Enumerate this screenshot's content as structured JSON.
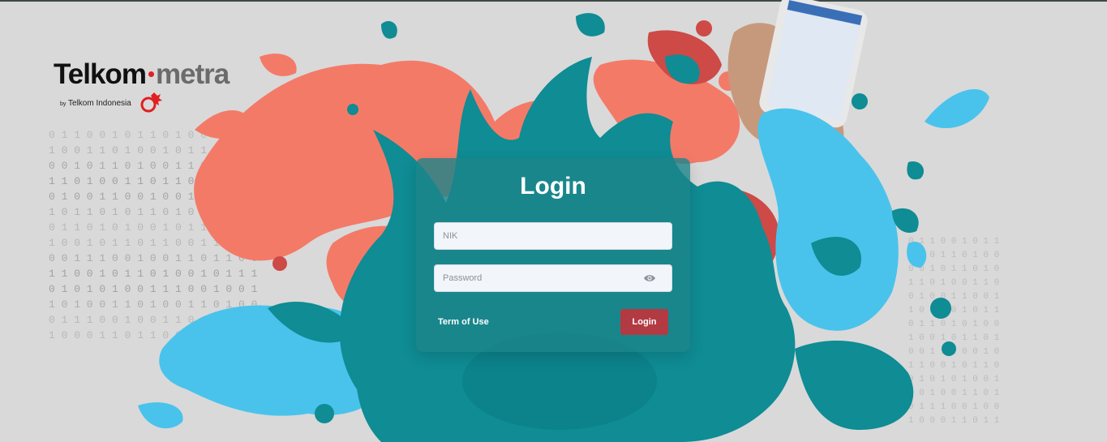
{
  "brand": {
    "name_part1": "Telkom",
    "name_part2": "metra",
    "by_label": "by",
    "parent": "Telkom Indonesia"
  },
  "login_form": {
    "title": "Login",
    "nik_placeholder": "NIK",
    "password_placeholder": "Password",
    "term_link": "Term of Use",
    "submit_label": "Login",
    "accent_color": "#b23a42",
    "card_color": "#1c848a"
  },
  "background": {
    "binary_rows": [
      "0 1 1 0 0 1 0 1 1 0 1 0 0 1 1 0 1",
      "1 0 0 1 1 0 1 0 0 1 0 1 1 0 0 1 0",
      "0 0 1 0 1 1 0 1 0 0 1 1 0 1 0 1 1",
      "1 1 0 1 0 0 1 1 0 1 1 0 1 0 1 0 0",
      "0 1 0 0 1 1 0 0 1 0 0 1 1 0 1 1 0",
      "1 0 1 1 0 1 0 1 1 0 1 0 0 1 0 0 1",
      "0 1 1 0 1 0 1 0 0 1 0 1 1 0 1 0 1",
      "1 0 0 1 0 1 1 0 1 1 0 0 1 1 0 1 0",
      "0 0 1 1 1 0 0 1 0 0 1 1 0 1 1 0 0",
      "1 1 0 0 1 0 1 1 0 1 0 0 1 0 1 1 1",
      "0 1 0 1 0 1 0 0 1 1 1 0 0 1 0 0 1",
      "1 0 1 0 0 1 1 0 1 0 0 1 1 0 1 0 0",
      "0 1 1 1 0 0 1 0 0 1 1 0 1 1 0 1 0",
      "1 0 0 0 1 1 0 1 1 0 0 1 0 0 1 1 1"
    ]
  }
}
